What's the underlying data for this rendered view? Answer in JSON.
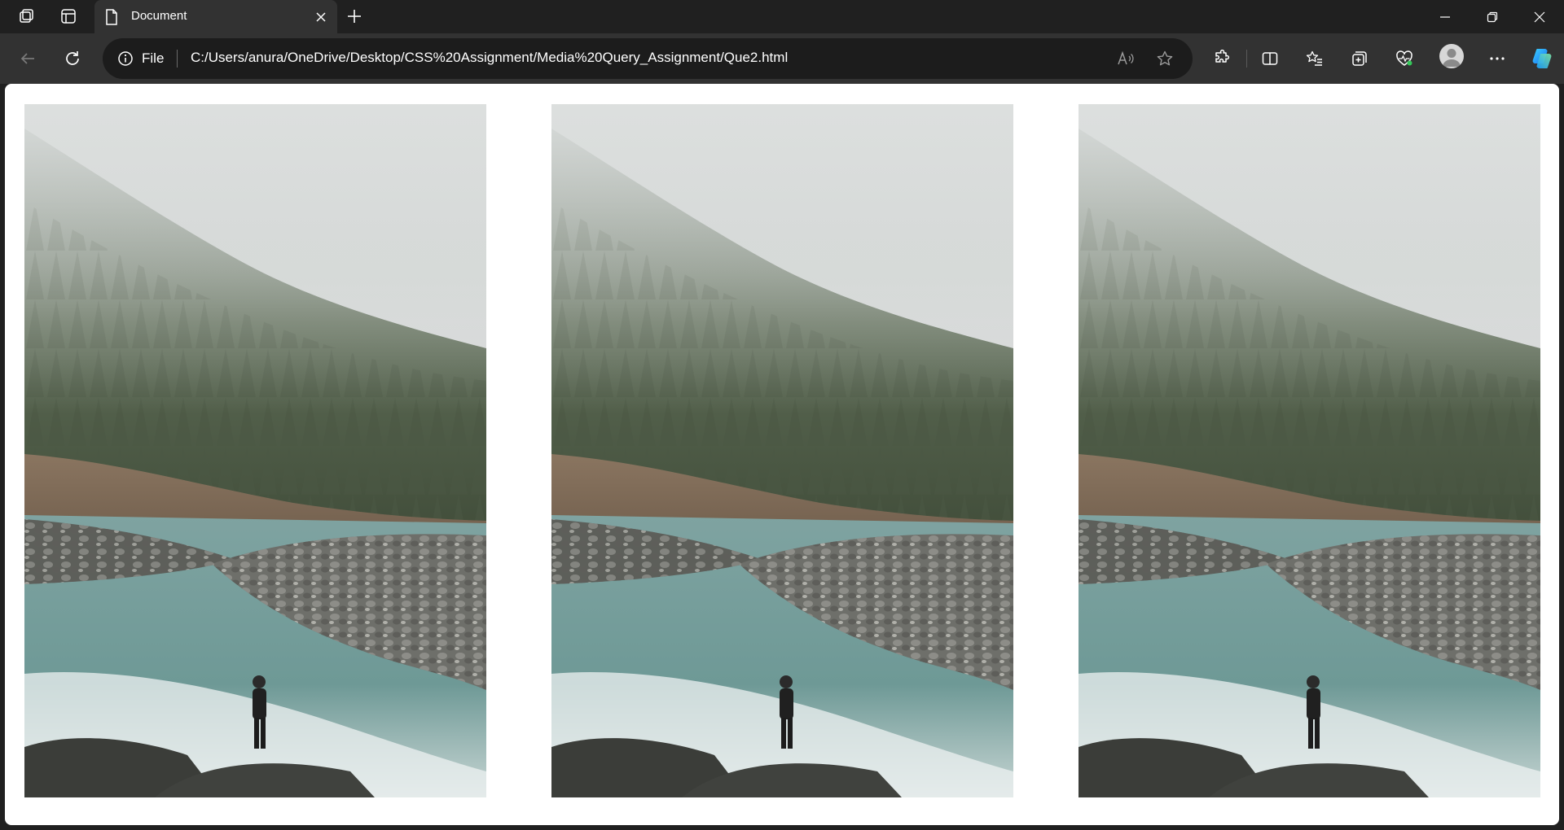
{
  "browser": {
    "tab": {
      "title": "Document"
    },
    "address": {
      "site_info_label": "File",
      "url": "C:/Users/anura/OneDrive/Desktop/CSS%20Assignment/Media%20Query_Assignment/Que2.html"
    },
    "icons": {
      "workspaces": "workspaces-icon",
      "tab_actions": "tab-actions-icon",
      "new_tab": "plus-icon",
      "back": "back-arrow-icon",
      "refresh": "refresh-icon",
      "read_aloud": "read-aloud-icon",
      "favorite": "star-icon",
      "extensions": "puzzle-icon",
      "split_screen": "split-screen-icon",
      "favorites": "favorites-list-icon",
      "collections": "collections-icon",
      "browser_essentials": "heart-pulse-icon",
      "more": "more-dots-icon",
      "copilot": "copilot-icon"
    }
  },
  "colors": {
    "chrome_dark": "#202020",
    "toolbar": "#323232",
    "page_background": "#ffffff"
  },
  "page": {
    "images": [
      {
        "description_id": "landscape-photo-1"
      },
      {
        "description_id": "landscape-photo-2"
      },
      {
        "description_id": "landscape-photo-3"
      }
    ]
  }
}
